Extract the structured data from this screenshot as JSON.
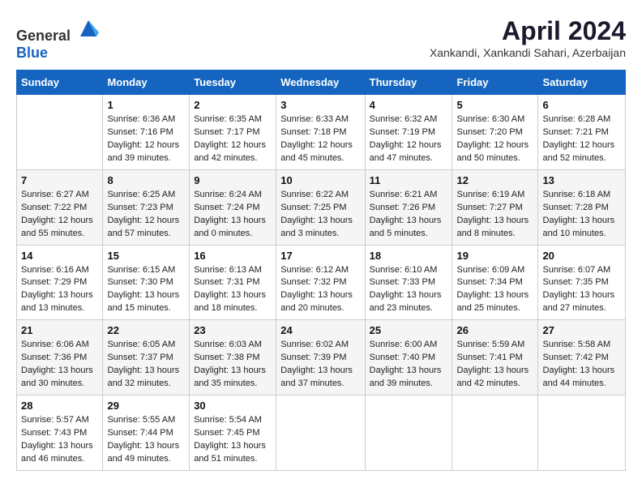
{
  "header": {
    "logo_general": "General",
    "logo_blue": "Blue",
    "title": "April 2024",
    "subtitle": "Xankandi, Xankandi Sahari, Azerbaijan"
  },
  "calendar": {
    "weekdays": [
      "Sunday",
      "Monday",
      "Tuesday",
      "Wednesday",
      "Thursday",
      "Friday",
      "Saturday"
    ],
    "weeks": [
      [
        {
          "day": "",
          "sunrise": "",
          "sunset": "",
          "daylight": ""
        },
        {
          "day": "1",
          "sunrise": "Sunrise: 6:36 AM",
          "sunset": "Sunset: 7:16 PM",
          "daylight": "Daylight: 12 hours and 39 minutes."
        },
        {
          "day": "2",
          "sunrise": "Sunrise: 6:35 AM",
          "sunset": "Sunset: 7:17 PM",
          "daylight": "Daylight: 12 hours and 42 minutes."
        },
        {
          "day": "3",
          "sunrise": "Sunrise: 6:33 AM",
          "sunset": "Sunset: 7:18 PM",
          "daylight": "Daylight: 12 hours and 45 minutes."
        },
        {
          "day": "4",
          "sunrise": "Sunrise: 6:32 AM",
          "sunset": "Sunset: 7:19 PM",
          "daylight": "Daylight: 12 hours and 47 minutes."
        },
        {
          "day": "5",
          "sunrise": "Sunrise: 6:30 AM",
          "sunset": "Sunset: 7:20 PM",
          "daylight": "Daylight: 12 hours and 50 minutes."
        },
        {
          "day": "6",
          "sunrise": "Sunrise: 6:28 AM",
          "sunset": "Sunset: 7:21 PM",
          "daylight": "Daylight: 12 hours and 52 minutes."
        }
      ],
      [
        {
          "day": "7",
          "sunrise": "Sunrise: 6:27 AM",
          "sunset": "Sunset: 7:22 PM",
          "daylight": "Daylight: 12 hours and 55 minutes."
        },
        {
          "day": "8",
          "sunrise": "Sunrise: 6:25 AM",
          "sunset": "Sunset: 7:23 PM",
          "daylight": "Daylight: 12 hours and 57 minutes."
        },
        {
          "day": "9",
          "sunrise": "Sunrise: 6:24 AM",
          "sunset": "Sunset: 7:24 PM",
          "daylight": "Daylight: 13 hours and 0 minutes."
        },
        {
          "day": "10",
          "sunrise": "Sunrise: 6:22 AM",
          "sunset": "Sunset: 7:25 PM",
          "daylight": "Daylight: 13 hours and 3 minutes."
        },
        {
          "day": "11",
          "sunrise": "Sunrise: 6:21 AM",
          "sunset": "Sunset: 7:26 PM",
          "daylight": "Daylight: 13 hours and 5 minutes."
        },
        {
          "day": "12",
          "sunrise": "Sunrise: 6:19 AM",
          "sunset": "Sunset: 7:27 PM",
          "daylight": "Daylight: 13 hours and 8 minutes."
        },
        {
          "day": "13",
          "sunrise": "Sunrise: 6:18 AM",
          "sunset": "Sunset: 7:28 PM",
          "daylight": "Daylight: 13 hours and 10 minutes."
        }
      ],
      [
        {
          "day": "14",
          "sunrise": "Sunrise: 6:16 AM",
          "sunset": "Sunset: 7:29 PM",
          "daylight": "Daylight: 13 hours and 13 minutes."
        },
        {
          "day": "15",
          "sunrise": "Sunrise: 6:15 AM",
          "sunset": "Sunset: 7:30 PM",
          "daylight": "Daylight: 13 hours and 15 minutes."
        },
        {
          "day": "16",
          "sunrise": "Sunrise: 6:13 AM",
          "sunset": "Sunset: 7:31 PM",
          "daylight": "Daylight: 13 hours and 18 minutes."
        },
        {
          "day": "17",
          "sunrise": "Sunrise: 6:12 AM",
          "sunset": "Sunset: 7:32 PM",
          "daylight": "Daylight: 13 hours and 20 minutes."
        },
        {
          "day": "18",
          "sunrise": "Sunrise: 6:10 AM",
          "sunset": "Sunset: 7:33 PM",
          "daylight": "Daylight: 13 hours and 23 minutes."
        },
        {
          "day": "19",
          "sunrise": "Sunrise: 6:09 AM",
          "sunset": "Sunset: 7:34 PM",
          "daylight": "Daylight: 13 hours and 25 minutes."
        },
        {
          "day": "20",
          "sunrise": "Sunrise: 6:07 AM",
          "sunset": "Sunset: 7:35 PM",
          "daylight": "Daylight: 13 hours and 27 minutes."
        }
      ],
      [
        {
          "day": "21",
          "sunrise": "Sunrise: 6:06 AM",
          "sunset": "Sunset: 7:36 PM",
          "daylight": "Daylight: 13 hours and 30 minutes."
        },
        {
          "day": "22",
          "sunrise": "Sunrise: 6:05 AM",
          "sunset": "Sunset: 7:37 PM",
          "daylight": "Daylight: 13 hours and 32 minutes."
        },
        {
          "day": "23",
          "sunrise": "Sunrise: 6:03 AM",
          "sunset": "Sunset: 7:38 PM",
          "daylight": "Daylight: 13 hours and 35 minutes."
        },
        {
          "day": "24",
          "sunrise": "Sunrise: 6:02 AM",
          "sunset": "Sunset: 7:39 PM",
          "daylight": "Daylight: 13 hours and 37 minutes."
        },
        {
          "day": "25",
          "sunrise": "Sunrise: 6:00 AM",
          "sunset": "Sunset: 7:40 PM",
          "daylight": "Daylight: 13 hours and 39 minutes."
        },
        {
          "day": "26",
          "sunrise": "Sunrise: 5:59 AM",
          "sunset": "Sunset: 7:41 PM",
          "daylight": "Daylight: 13 hours and 42 minutes."
        },
        {
          "day": "27",
          "sunrise": "Sunrise: 5:58 AM",
          "sunset": "Sunset: 7:42 PM",
          "daylight": "Daylight: 13 hours and 44 minutes."
        }
      ],
      [
        {
          "day": "28",
          "sunrise": "Sunrise: 5:57 AM",
          "sunset": "Sunset: 7:43 PM",
          "daylight": "Daylight: 13 hours and 46 minutes."
        },
        {
          "day": "29",
          "sunrise": "Sunrise: 5:55 AM",
          "sunset": "Sunset: 7:44 PM",
          "daylight": "Daylight: 13 hours and 49 minutes."
        },
        {
          "day": "30",
          "sunrise": "Sunrise: 5:54 AM",
          "sunset": "Sunset: 7:45 PM",
          "daylight": "Daylight: 13 hours and 51 minutes."
        },
        {
          "day": "",
          "sunrise": "",
          "sunset": "",
          "daylight": ""
        },
        {
          "day": "",
          "sunrise": "",
          "sunset": "",
          "daylight": ""
        },
        {
          "day": "",
          "sunrise": "",
          "sunset": "",
          "daylight": ""
        },
        {
          "day": "",
          "sunrise": "",
          "sunset": "",
          "daylight": ""
        }
      ]
    ]
  }
}
